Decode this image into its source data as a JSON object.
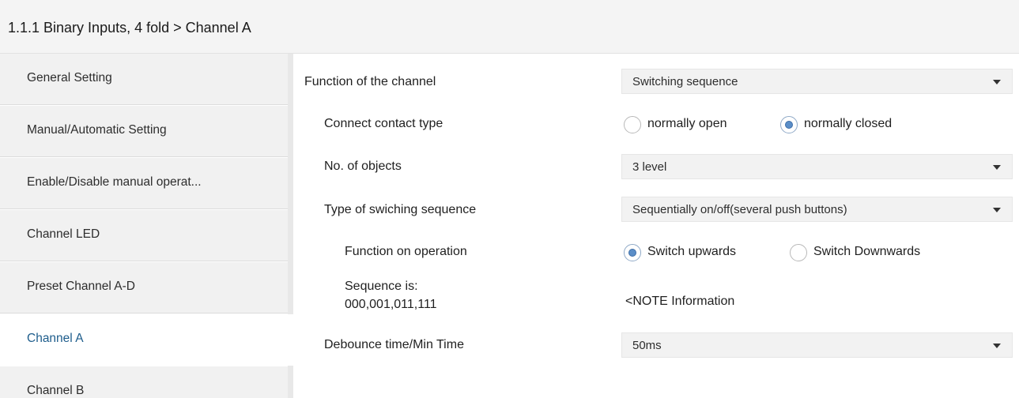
{
  "breadcrumb": "1.1.1 Binary Inputs, 4 fold > Channel A",
  "sidebar": {
    "items": [
      {
        "label": "General Setting"
      },
      {
        "label": "Manual/Automatic Setting"
      },
      {
        "label": "Enable/Disable manual operat..."
      },
      {
        "label": "Channel LED"
      },
      {
        "label": "Preset Channel A-D"
      },
      {
        "label": "Channel A",
        "active": true
      },
      {
        "label": "Channel B"
      }
    ]
  },
  "params": {
    "function_label": "Function of the channel",
    "function_value": "Switching sequence",
    "contact_label": "Connect contact type",
    "contact_options": [
      "normally open",
      "normally closed"
    ],
    "contact_selected": "normally closed",
    "objects_label": "No. of objects",
    "objects_value": "3 level",
    "sequence_type_label": "Type of swiching sequence",
    "sequence_type_value": "Sequentially on/off(several push buttons)",
    "operation_label": "Function on operation",
    "operation_options": [
      "Switch upwards",
      "Switch Downwards"
    ],
    "operation_selected": "Switch upwards",
    "sequence_label_line1": "Sequence is:",
    "sequence_label_line2": "000,001,011,111",
    "sequence_note": "<NOTE Information",
    "debounce_label": "Debounce time/Min Time",
    "debounce_value": "50ms"
  },
  "colors": {
    "active_item_text": "#1e5d8c",
    "radio_fill": "#5b8ec8",
    "sidebar_bg": "#f1f1f1",
    "dropdown_bg": "#f2f2f2"
  },
  "icons": {
    "dropdown_caret": "chevron-down-icon",
    "radio": "radio-button-icon"
  }
}
